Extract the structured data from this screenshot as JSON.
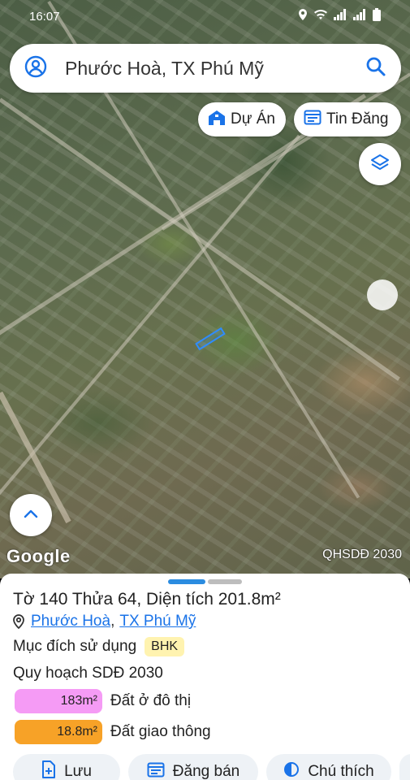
{
  "status_bar": {
    "time": "16:07"
  },
  "search": {
    "title": "Phước Hoà, TX Phú Mỹ"
  },
  "chips": {
    "du_an": "Dự Án",
    "tin_dang": "Tin Đăng"
  },
  "map": {
    "logo": "Google",
    "layer_label": "QHSDĐ 2030"
  },
  "sheet": {
    "title": "Tờ 140 Thửa 64, Diện tích 201.8m²",
    "location": {
      "ward": "Phước Hoà",
      "separator": ",",
      "town": "TX Phú Mỹ"
    },
    "purpose_label": "Mục đích sử dụng",
    "purpose_value": "BHK",
    "plan_title": "Quy hoạch SDĐ 2030",
    "zones": [
      {
        "area": "183m²",
        "label": "Đất ở đô thị",
        "color": "#f59bf5"
      },
      {
        "area": "18.8m²",
        "label": "Đất giao thông",
        "color": "#f7a227"
      }
    ],
    "actions": {
      "save": "Lưu",
      "post_sale": "Đăng bán",
      "legend": "Chú thích"
    }
  },
  "colors": {
    "accent": "#2b8ce0",
    "link": "#1a73e8"
  }
}
